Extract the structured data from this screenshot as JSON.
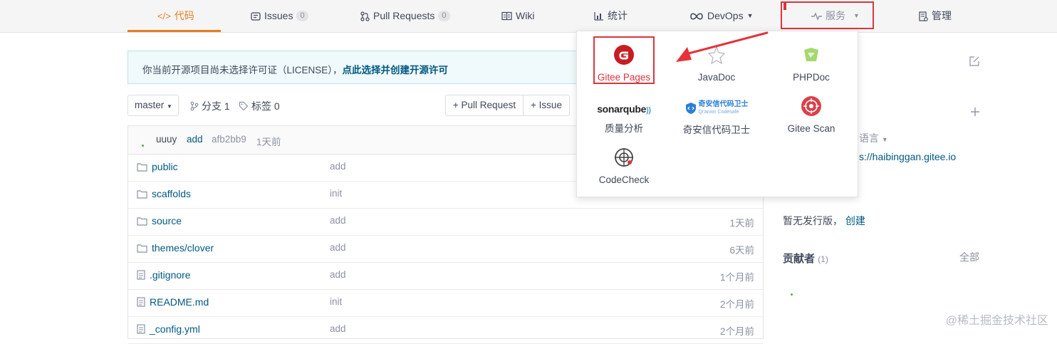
{
  "nav": {
    "code": "代码",
    "issues": "Issues",
    "issues_count": "0",
    "pull_requests": "Pull Requests",
    "pr_count": "0",
    "wiki": "Wiki",
    "stats": "统计",
    "devops": "DevOps",
    "services": "服务",
    "manage": "管理"
  },
  "license": {
    "text": "你当前开源项目尚未选择许可证（LICENSE），",
    "link": "点此选择并创建开源许可"
  },
  "toolbar": {
    "branch": "master",
    "branches": "分支 1",
    "tags": "标签 0",
    "pull_request_btn": "+ Pull Request",
    "issue_btn": "+ Issue"
  },
  "commit": {
    "author": "uuuy",
    "message": "add",
    "hash": "afb2bb9",
    "time": "1天前"
  },
  "files": [
    {
      "name": "public",
      "type": "folder",
      "msg": "add",
      "time": ""
    },
    {
      "name": "scaffolds",
      "type": "folder",
      "msg": "init",
      "time": ""
    },
    {
      "name": "source",
      "type": "folder",
      "msg": "add",
      "time": "1天前"
    },
    {
      "name": "themes/clover",
      "type": "folder",
      "msg": "add",
      "time": "6天前"
    },
    {
      "name": ".gitignore",
      "type": "file",
      "msg": "add",
      "time": "1个月前"
    },
    {
      "name": "README.md",
      "type": "file",
      "msg": "init",
      "time": "2个月前"
    },
    {
      "name": "_config.yml",
      "type": "file",
      "msg": "add",
      "time": "2个月前"
    }
  ],
  "services": {
    "gitee_pages": "Gitee Pages",
    "javadoc": "JavaDoc",
    "phpdoc": "PHPDoc",
    "sonarqube_logo": "sonarqube",
    "quality": "质量分析",
    "qianxin_logo": "奇安信代码卫士",
    "qianxin_sub": "Qi'anxin Codesafe",
    "qianxin": "奇安信代码卫士",
    "gitee_scan": "Gitee Scan",
    "codecheck": "CodeCheck"
  },
  "sidebar": {
    "lang": "语言",
    "url": "s://haibinggan.gitee.io",
    "release_empty": "暂无发行版，",
    "release_create": "创建",
    "contributors": "贡献者",
    "contributors_count": "(1)",
    "all": "全部"
  },
  "watermark": "@稀土掘金技术社区",
  "colors": {
    "accent": "#e67e22",
    "highlight_red": "#d9363e",
    "link": "#005980"
  }
}
